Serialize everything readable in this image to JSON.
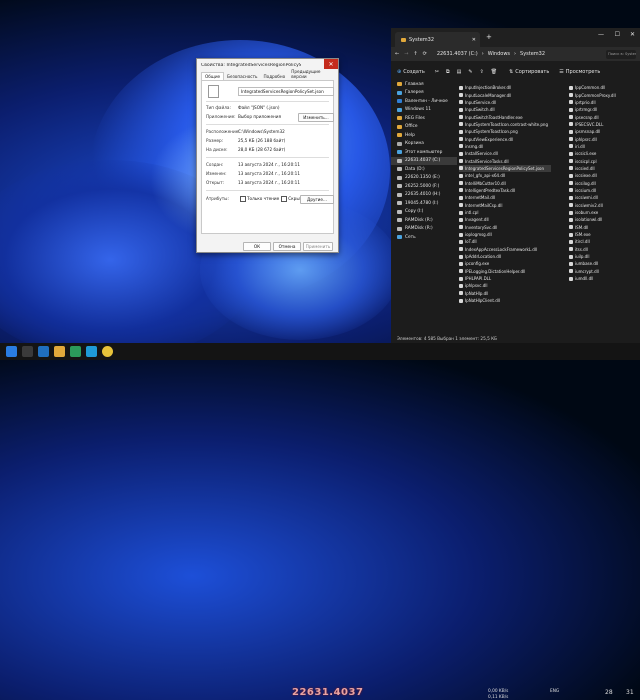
{
  "dialog": {
    "title": "Свойства: IntegratedServicesRegionPolicySet.json",
    "tabs": [
      "Общие",
      "Безопасность",
      "Подробно",
      "Предыдущие версии"
    ],
    "filename": "IntegratedServicesRegionPolicySet.json",
    "type_label": "Тип файла:",
    "type_value": "Файл \"JSON\" (.json)",
    "app_label": "Приложение:",
    "app_value": "Выбор приложения",
    "change_btn": "Изменить...",
    "location_label": "Расположение:",
    "location_value": "C:\\Windows\\System32",
    "size_label": "Размер:",
    "size_value": "25,5 КБ (26 188 байт)",
    "disk_label": "На диске:",
    "disk_value": "28,0 КБ (28 672 байт)",
    "created_label": "Создан:",
    "created_value": "13 августа 2024 г., 16:20:11",
    "modified_label": "Изменен:",
    "modified_value": "13 августа 2024 г., 16:20:11",
    "opened_label": "Открыт:",
    "opened_value": "13 августа 2024 г., 16:20:11",
    "attr_label": "Атрибуты:",
    "readonly_label": "Только чтение",
    "hidden_label": "Скрытый",
    "other_btn": "Другие...",
    "ok": "ОК",
    "cancel": "Отмена",
    "apply": "Применить"
  },
  "explorer": {
    "tab_title": "System32",
    "address": [
      "22631.4037 (C:)",
      "Windows",
      "System32"
    ],
    "search_placeholder": "Поиск в: System32",
    "create": "Создать",
    "sort": "Сортировать",
    "view": "Просмотреть",
    "nav": [
      {
        "label": "Главная",
        "color": "#e2a93b"
      },
      {
        "label": "Галерея",
        "color": "#4aa3df"
      },
      {
        "label": "Валентин - Личное",
        "color": "#2f7fd6"
      },
      {
        "label": "Windows 11",
        "color": "#4aa3df"
      },
      {
        "label": "REG Files",
        "color": "#e2a93b"
      },
      {
        "label": "Office",
        "color": "#e2a93b"
      },
      {
        "label": "Help",
        "color": "#e2a93b"
      },
      {
        "label": "Корзина",
        "color": "#aaaaaa"
      },
      {
        "label": "Этот компьютер",
        "color": "#4aa3df"
      },
      {
        "label": "22631.4037 (C:)",
        "color": "#bbbbbb"
      },
      {
        "label": "Data (D:)",
        "color": "#bbbbbb"
      },
      {
        "label": "22620.1350 (E:)",
        "color": "#bbbbbb"
      },
      {
        "label": "26252.5000 (F:)",
        "color": "#bbbbbb"
      },
      {
        "label": "22635.4010 (H:)",
        "color": "#bbbbbb"
      },
      {
        "label": "19045.4780 (I:)",
        "color": "#bbbbbb"
      },
      {
        "label": "Copy (I:)",
        "color": "#bbbbbb"
      },
      {
        "label": "RAMDisk (R:)",
        "color": "#bbbbbb"
      },
      {
        "label": "RAMDisk (R:)",
        "color": "#bbbbbb"
      },
      {
        "label": "Сеть",
        "color": "#4aa3df"
      }
    ],
    "col1": [
      "InputInjectionBroker.dll",
      "InputLocaleManager.dll",
      "InputService.dll",
      "InputSwitch.dll",
      "InputSwitchToastHandler.exe",
      "InputSystemToastIcon.contrast-white.png",
      "InputSystemToastIcon.png",
      "InputViewExperience.dll",
      "insmg.dll",
      "InstallService.dll",
      "InstallServiceTasks.dll",
      "IntegratedServicesRegionPolicySet.json",
      "intel_gfx_api-x64.dll",
      "IntelliMbCutter10.dll",
      "IntelligentPredtexTask.dll",
      "InternetMail.dll",
      "InternetMailCsp.dll",
      "intl.cpl",
      "Invagent.dll",
      "InventorySvc.dll",
      "ioplogmsg.dll",
      "IoT.dll",
      "IndexAppAccessLockFrameworkL.dll",
      "IpAddrLocation.dll",
      "ipconfig.exe",
      "IPELogging.DictationHelper.dll",
      "IPHLPAPI.DLL",
      "iphlpsvc.dll",
      "IpNatHlp.dll",
      "IpNatHlpClient.dll"
    ],
    "col2": [
      "IppCommon.dll",
      "IppCommonProxy.dll",
      "iprtprio.dll",
      "iprtrmgr.dll",
      "ipsecsnp.dll",
      "IPSECSVC.DLL",
      "ipsmsnap.dll",
      "iphlpsrc.dll",
      "iri.dll",
      "iscsicli.exe",
      "iscsicpl.cpl",
      "iscsied.dll",
      "iscsiexe.dll",
      "iscsilog.dll",
      "iscsium.dll",
      "iscsiwmi.dll",
      "iscsiwmiv2.dll",
      "isoburn.exe",
      "isolationwl.dll",
      "ISM.dll",
      "ISM.exe",
      "itircl.dll",
      "itss.dll",
      "iuilp.dll",
      "iumbase.dll",
      "iumcrypt.dll",
      "iumdll.dll"
    ],
    "status": "Элементов: 4 585     Выбран 1 элемент: 25,5 КБ"
  },
  "taskbar": {
    "watermark": "22631.4037",
    "lang": "ENG",
    "net_up": "0,00 KB/s",
    "net_down": "0,11 KB/s",
    "temp": "28",
    "day": "31"
  }
}
